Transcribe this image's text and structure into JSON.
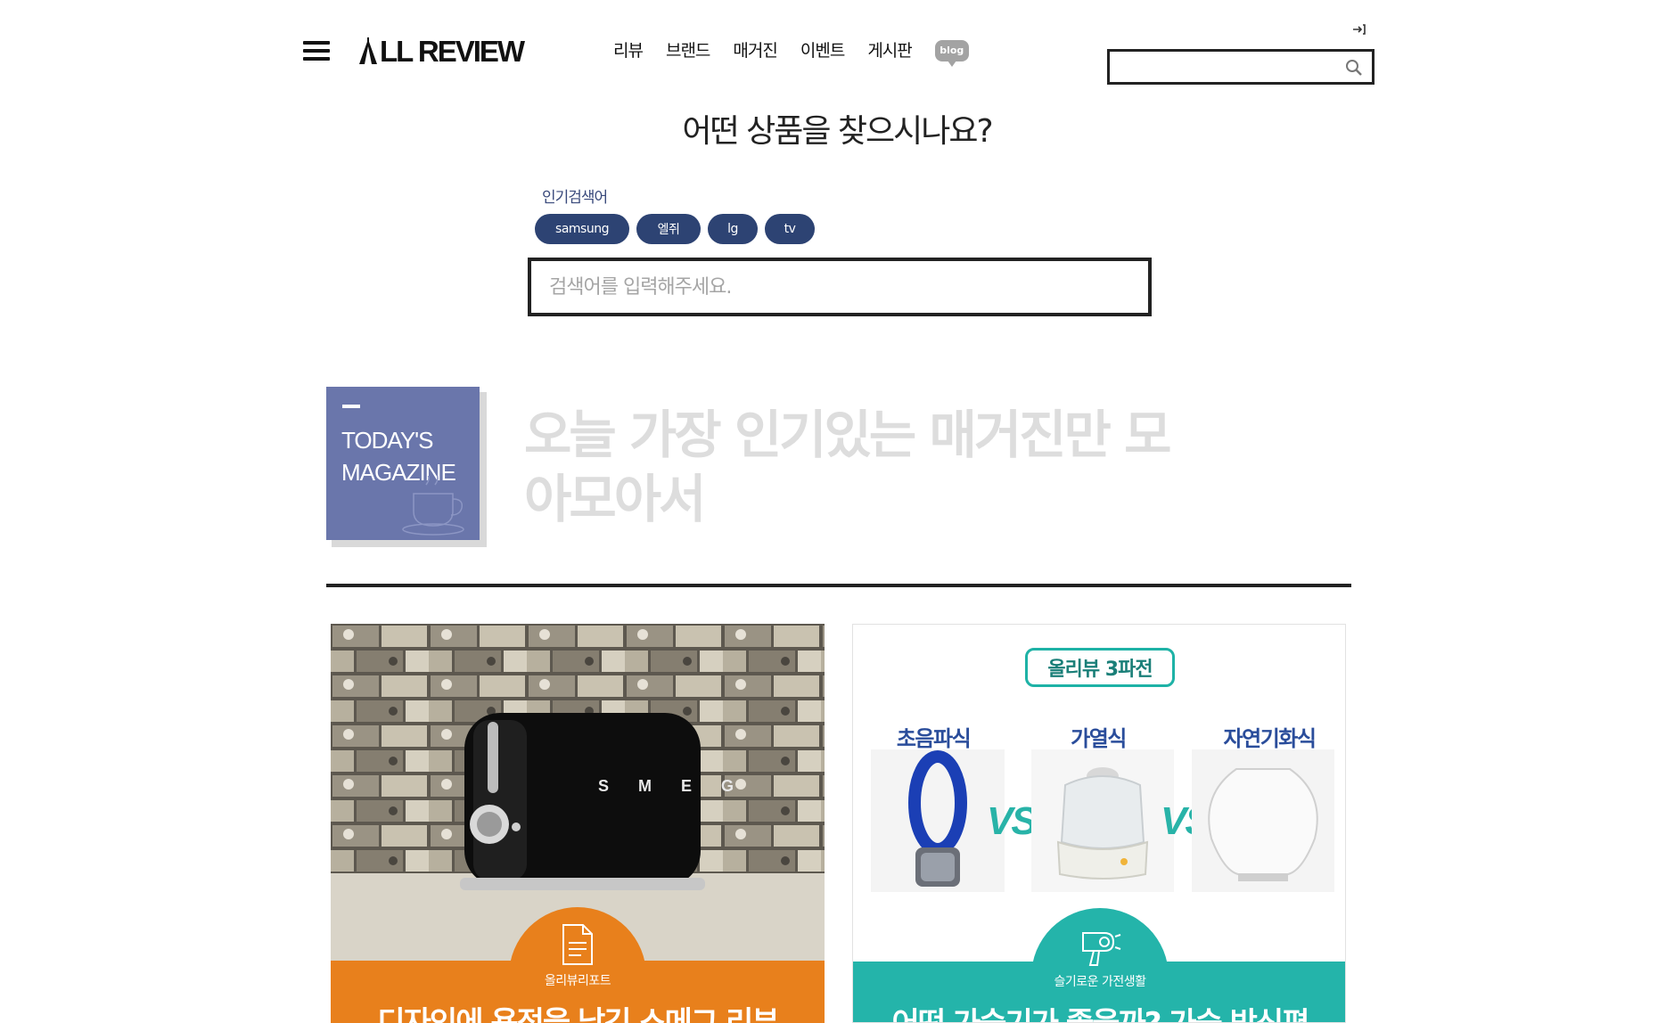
{
  "header": {
    "logo_text": "LL REVIEW",
    "nav": [
      "리뷰",
      "브랜드",
      "매거진",
      "이벤트",
      "게시판"
    ],
    "blog_badge": "blog",
    "search_placeholder": ""
  },
  "search_hero": {
    "title": "어떤 상품을 찾으시나요?",
    "popular_label": "인기검색어",
    "popular_tags": [
      "samsung",
      "엘쥐",
      "lg",
      "tv"
    ],
    "input_placeholder": "검색어를 입력해주세요."
  },
  "todays_magazine": {
    "badge_text": "TODAY'S\nMAGAZINE",
    "headline": "오늘 가장 인기있는 매거진만 모아모아서"
  },
  "cards": [
    {
      "category": "올리뷰리포트",
      "title": "디자인에 욕정을 남긴 스메그 리뷰",
      "product_brand_text": "S M E G",
      "band_color": "#e8801c"
    },
    {
      "badge": "올리뷰 3파전",
      "types": [
        "초음파식",
        "가열식",
        "자연기화식"
      ],
      "vs_text": "VS",
      "category": "슬기로운 가전생활",
      "title": "어떤 가습기가 좋을까? 가습 방식편",
      "band_color": "#24b4aa"
    }
  ],
  "colors": {
    "tag_bg": "#2d4373",
    "badge_bg": "#6a76ab",
    "headline_muted": "#dddddd"
  },
  "icons": [
    "hamburger-icon",
    "login-icon",
    "search-icon",
    "blog-icon",
    "coffee-cup-icon",
    "document-icon",
    "hair-dryer-icon"
  ]
}
